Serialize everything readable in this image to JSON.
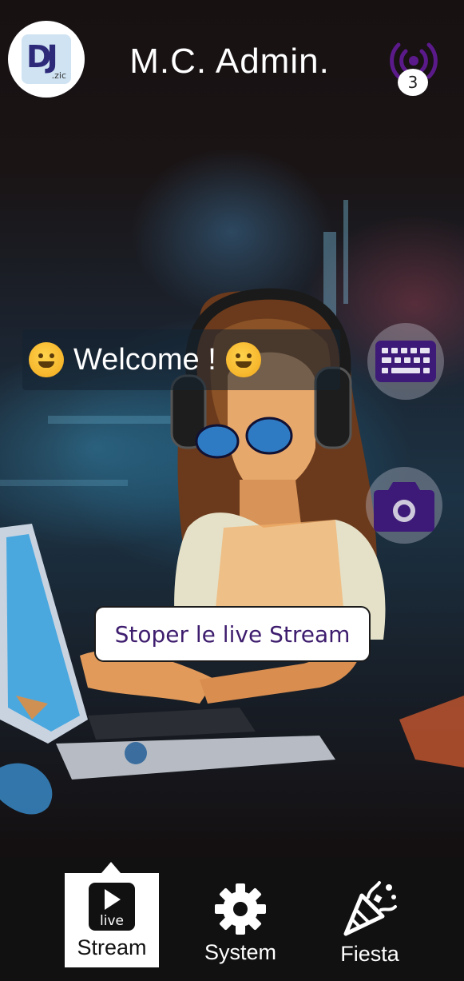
{
  "header": {
    "logo_text": "DJ",
    "logo_sub": ".zic",
    "title": "M.C. Admin.",
    "listeners_count": "3",
    "signal_icon": "broadcast-icon"
  },
  "welcome": {
    "text": "Welcome !",
    "emoji_icon": "hugging-face-emoji"
  },
  "side_buttons": {
    "keyboard_icon": "keyboard-icon",
    "camera_icon": "camera-icon"
  },
  "stop_button": {
    "label": "Stoper le live Stream"
  },
  "nav": {
    "items": [
      {
        "label": "Stream",
        "icon": "live-play-icon",
        "icon_text": "live",
        "active": true
      },
      {
        "label": "System",
        "icon": "gear-icon",
        "active": false
      },
      {
        "label": "Fiesta",
        "icon": "party-popper-icon",
        "active": false
      }
    ]
  },
  "colors": {
    "accent": "#3e1d6e",
    "nav_bg": "#111111",
    "signal": "#5b1a8a"
  }
}
